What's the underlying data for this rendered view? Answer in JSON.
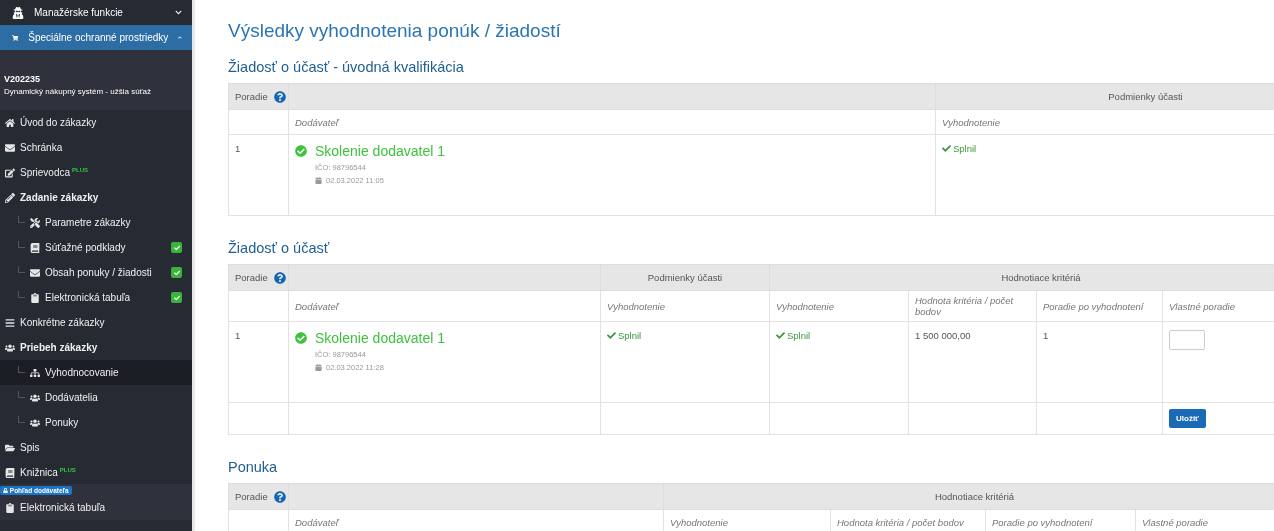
{
  "sidebar": {
    "menus": [
      {
        "label": "Manažérske funkcie",
        "expanded": false,
        "selected": false
      },
      {
        "label": "Špeciálne ochranné prostriedky",
        "expanded": true,
        "selected": true
      }
    ],
    "project": {
      "code": "V202235",
      "name": "Dynamický nákupný systém - užšia súťaž"
    },
    "items": [
      {
        "label": "Úvod do zákazky",
        "bold": false,
        "selected": false
      },
      {
        "label": "Schránka",
        "bold": false,
        "selected": false
      },
      {
        "label": "Sprievodca",
        "badge": "PLUS",
        "bold": false,
        "selected": false
      },
      {
        "label": "Zadanie zákazky",
        "bold": true,
        "selected": false,
        "children": [
          {
            "label": "Parametre zákazky",
            "done": false,
            "selected": false
          },
          {
            "label": "Súťažné podklady",
            "done": true,
            "selected": false
          },
          {
            "label": "Obsah ponuky / žiadosti",
            "done": true,
            "selected": false
          },
          {
            "label": "Elektronická tabuľa",
            "done": true,
            "selected": false
          }
        ]
      },
      {
        "label": "Konkrétne zákazky",
        "bold": false,
        "selected": false
      },
      {
        "label": "Priebeh zákazky",
        "bold": true,
        "selected": false,
        "children": [
          {
            "label": "Vyhodnocovanie",
            "done": false,
            "selected": true
          },
          {
            "label": "Dodávatelia",
            "done": false,
            "selected": false
          },
          {
            "label": "Ponuky",
            "done": false,
            "selected": false
          }
        ]
      },
      {
        "label": "Spis",
        "bold": false,
        "selected": false
      },
      {
        "label": "Knižnica",
        "badge": "PLUS",
        "bold": false,
        "selected": false
      }
    ],
    "supplier_view": {
      "label": "Pohľad dodávateľa",
      "items": [
        {
          "label": "Elektronická tabuľa"
        }
      ]
    }
  },
  "main": {
    "title": "Výsledky vyhodnotenia ponúk / žiadostí",
    "sections": [
      {
        "heading": "Žiadosť o účasť - úvodná kvalifikácia",
        "table": {
          "header_groups": [
            {
              "label": "Poradie",
              "help": true
            },
            {
              "columns": [
                "Dodávateľ"
              ]
            },
            {
              "label": "Podmienky účasti",
              "columns": [
                "Vyhodnotenie"
              ]
            }
          ],
          "rows": [
            {
              "rank": "1",
              "supplier": {
                "name": "Skolenie dodavatel 1",
                "verified": true,
                "ico": "IČO: 98796544",
                "date": "02.03.2022 11:05"
              },
              "cells": [
                {
                  "kind": "status",
                  "text": "Splnil",
                  "passed": true
                }
              ]
            }
          ]
        }
      },
      {
        "heading": "Žiadosť o účasť",
        "table": {
          "header_groups": [
            {
              "label": "Poradie",
              "help": true
            },
            {
              "columns": [
                "Dodávateľ"
              ]
            },
            {
              "label": "Podmienky účasti",
              "columns": [
                "Vyhodnotenie"
              ]
            },
            {
              "label": "Hodnotiace kritériá",
              "columns": [
                "Vyhodnotenie",
                "Hodnota kritéria / počet bodov",
                "Poradie po vyhodnotení",
                "Vlastné poradie"
              ]
            }
          ],
          "rows": [
            {
              "rank": "1",
              "supplier": {
                "name": "Skolenie dodavatel 1",
                "verified": true,
                "ico": "IČO: 98796544",
                "date": "02.03.2022 11:28"
              },
              "cells": [
                {
                  "kind": "status",
                  "text": "Splnil",
                  "passed": true
                },
                {
                  "kind": "status",
                  "text": "Splnil",
                  "passed": true
                },
                {
                  "kind": "text",
                  "text": "1 500 000,00"
                },
                {
                  "kind": "text",
                  "text": "1"
                },
                {
                  "kind": "input"
                }
              ]
            }
          ],
          "footer_button": "Uložiť"
        }
      },
      {
        "heading": "Ponuka",
        "table": {
          "header_groups": [
            {
              "label": "Poradie",
              "help": true
            },
            {
              "columns": [
                "Dodávateľ"
              ]
            },
            {
              "label": "Hodnotiace kritériá",
              "columns": [
                "Vyhodnotenie",
                "Hodnota kritéria / počet bodov",
                "Poradie po vyhodnotení",
                "Vlastné poradie"
              ]
            }
          ]
        }
      }
    ]
  }
}
